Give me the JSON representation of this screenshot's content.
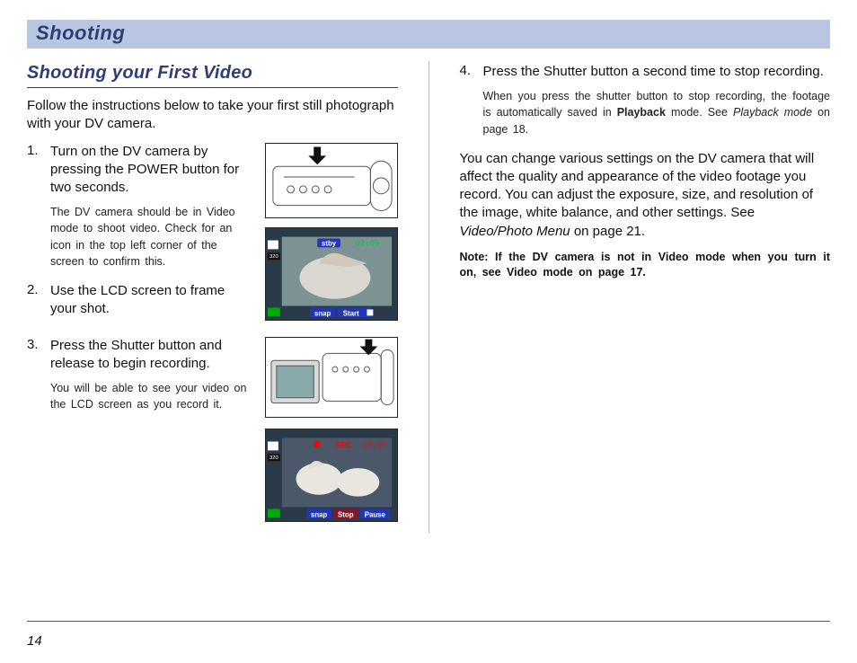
{
  "chapter_title": "Shooting",
  "section_title": "Shooting your First Video",
  "intro": "Follow the instructions below to take your first still photograph with your DV camera.",
  "left_steps": [
    {
      "num": "1.",
      "text": "Turn on the DV camera by pressing the POWER button for two seconds.",
      "desc": "The DV camera should be in Video mode to shoot video. Check for an icon in the top left corner of the screen to confirm this."
    },
    {
      "num": "2.",
      "text": "Use the LCD screen to frame your shot.",
      "desc": ""
    },
    {
      "num": "3.",
      "text": "Press the Shutter button and release to begin recording.",
      "desc": "You will be able to see your video on the LCD screen as you record it."
    }
  ],
  "right_step": {
    "num": "4.",
    "text": "Press the Shutter button  a second time to stop recording.",
    "desc1": "When you press the shutter button to stop recording, the footage is automatically saved in ",
    "desc_bold": "Playback",
    "desc2": " mode. See ",
    "desc_italic": "Playback mode",
    "desc3": " on page 18."
  },
  "right_body1a": "You can change various settings on the DV camera that will affect the quality and appearance of the video footage you record. You can adjust the exposure, size, and resolution of the image, white balance, and other settings. See ",
  "right_body1_italic": "Video/Photo Menu",
  "right_body1b": " on page 21.",
  "note": "Note: If the DV camera is not in Video mode when you turn it on, see Video mode on page 17.",
  "lcd1": {
    "stby": "stby",
    "time": "02:09",
    "snap": "snap",
    "start": "Start",
    "res": "320"
  },
  "lcd2": {
    "rec": "REC",
    "time": "02:09",
    "snap": "snap",
    "stop": "Stop",
    "pause": "Pause",
    "res": "320"
  },
  "page_number": "14"
}
